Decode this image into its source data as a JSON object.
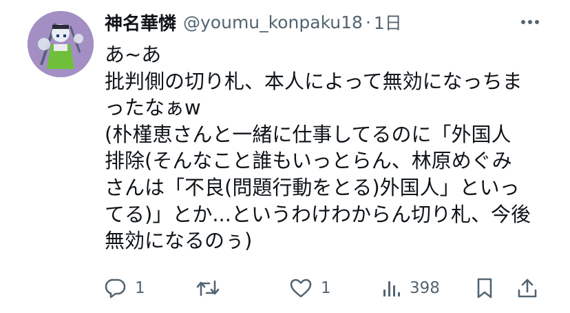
{
  "tweet": {
    "display_name": "神名華憐",
    "handle": "@youmu_konpaku18",
    "separator": "·",
    "time": "1日",
    "lines": [
      "あ~あ",
      "批判側の切り札、本人によって無効になっちま",
      "ったなぁw",
      "(朴槿恵さんと一緒に仕事してるのに「外国人",
      "排除(そんなこと誰もいっとらん、林原めぐみ",
      "さんは「不良(問題行動をとる)外国人」といっ",
      "てる)」とか...というわけわからん切り札、今後",
      "無効になるのぅ)"
    ]
  },
  "actions": {
    "reply_count": "1",
    "retweet_count": "",
    "like_count": "1",
    "views_count": "398"
  },
  "icons": {
    "more": "more-icon",
    "reply": "reply-icon",
    "retweet": "retweet-icon",
    "like": "heart-icon",
    "views": "views-icon",
    "bookmark": "bookmark-icon",
    "share": "share-icon"
  },
  "colors": {
    "text": "#0f1419",
    "secondary": "#536471"
  }
}
